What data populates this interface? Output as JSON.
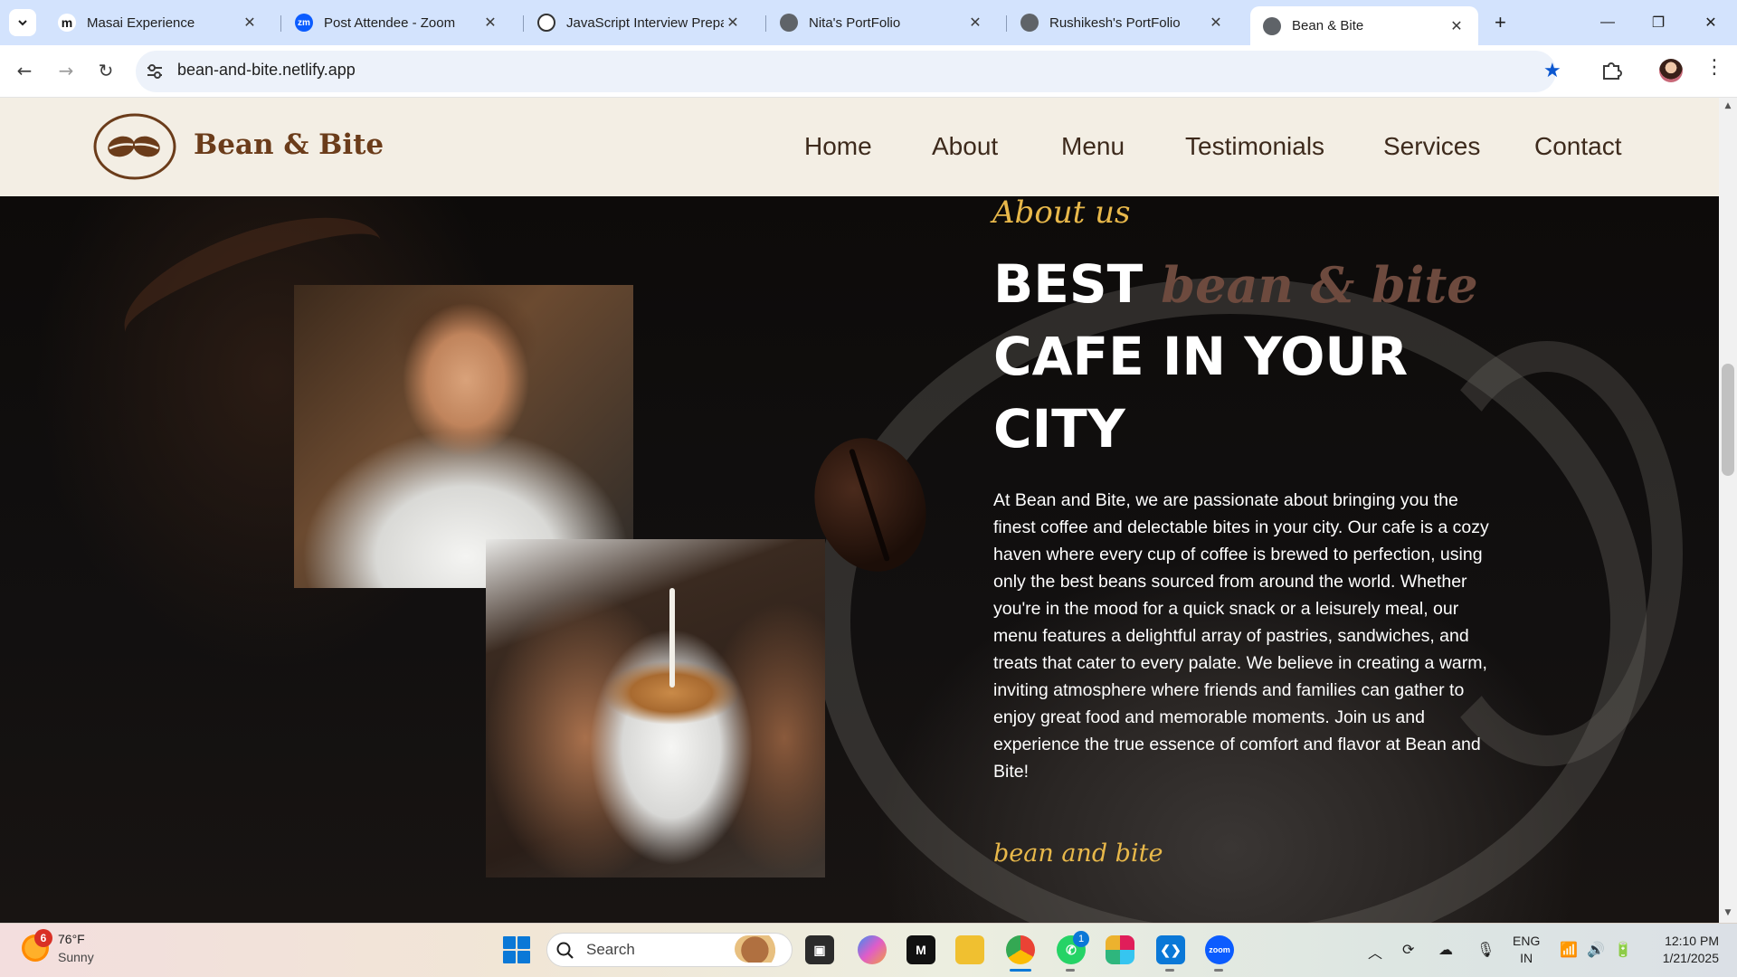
{
  "browser": {
    "tabs": [
      {
        "title": "Masai Experience",
        "favicon": "masai-icon"
      },
      {
        "title": "Post Attendee - Zoom",
        "favicon": "zoom-icon"
      },
      {
        "title": "JavaScript Interview Prepar",
        "favicon": "chatgpt-icon"
      },
      {
        "title": "Nita's PortFolio",
        "favicon": "globe-icon"
      },
      {
        "title": "Rushikesh's PortFolio",
        "favicon": "globe-icon"
      },
      {
        "title": "Bean & Bite",
        "favicon": "globe-icon",
        "active": true
      }
    ],
    "url": "bean-and-bite.netlify.app"
  },
  "site": {
    "brand": "Bean & Bite",
    "nav": [
      "Home",
      "About",
      "Menu",
      "Testimonials",
      "Services",
      "Contact"
    ],
    "about": {
      "eyebrow": "About us",
      "heading_best": "BEST",
      "heading_accent": "bean & bite",
      "heading_line2": "CAFE IN YOUR",
      "heading_line3": "CITY",
      "body": "At Bean and Bite, we are passionate about bringing you the finest coffee and delectable bites in your city. Our cafe is a cozy haven where every cup of coffee is brewed to perfection, using only the best beans sourced from around the world. Whether you're in the mood for a quick snack or a leisurely meal, our menu features a delightful array of pastries, sandwiches, and treats that cater to every palate. We believe in creating a warm, inviting atmosphere where friends and families can gather to enjoy great food and memorable moments. Join us and experience the true essence of comfort and flavor at Bean and Bite!",
      "signature": "bean and bite"
    },
    "colors": {
      "accent": "#e8b84a",
      "brand": "#6b3c1a",
      "nav_bg": "#f3eee4"
    }
  },
  "taskbar": {
    "weather": {
      "badge": "6",
      "temp": "76°F",
      "condition": "Sunny"
    },
    "search_label": "Search",
    "whatsapp_badge": "1",
    "lang_line1": "ENG",
    "lang_line2": "IN",
    "time": "12:10 PM",
    "date": "1/21/2025"
  }
}
